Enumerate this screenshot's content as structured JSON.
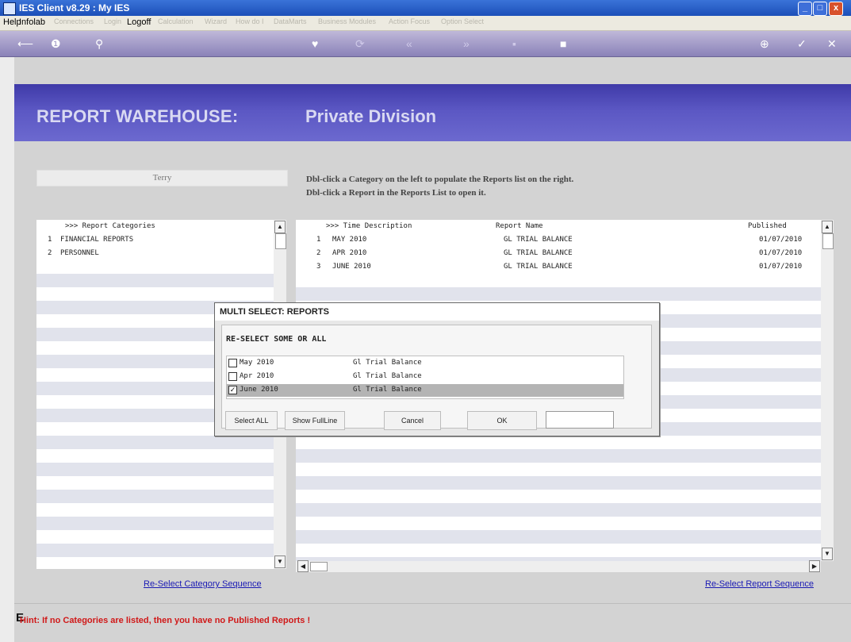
{
  "window": {
    "title": "IES Client v8.29 : My IES",
    "min": "_",
    "max": "□",
    "close": "x"
  },
  "menu": [
    "Help",
    "Infolab",
    "Connections",
    "Login",
    "Logoff",
    "Calculation",
    "Wizard",
    "How do I",
    "DataMarts",
    "Business Modules",
    "Action Focus",
    "Option Select"
  ],
  "toolbar": {
    "icons": [
      "back-arrow-icon",
      "info-icon",
      "search-icon",
      "heart-icon",
      "refresh-icon",
      "rewind-icon",
      "forward-icon",
      "stop-icon",
      "export-icon",
      "add-icon",
      "ok-icon",
      "close-icon"
    ]
  },
  "banner": {
    "title": "REPORT WAREHOUSE:",
    "subtitle": "Private Division"
  },
  "user": "Terry",
  "instructions": [
    "Dbl-click a Category on the left to populate the Reports list on the right.",
    "Dbl-click a Report in the Reports List to open it."
  ],
  "categories": {
    "header": ">>> Report Categories",
    "items": [
      {
        "num": "1",
        "name": "FINANCIAL REPORTS"
      },
      {
        "num": "2",
        "name": "PERSONNEL"
      }
    ]
  },
  "reports": {
    "headers": {
      "time": ">>> Time Description",
      "name": "Report Name",
      "published": "Published"
    },
    "rows": [
      {
        "num": "1",
        "time": "MAY 2010",
        "name": "GL TRIAL BALANCE",
        "published": "01/07/2010"
      },
      {
        "num": "2",
        "time": "APR 2010",
        "name": "GL TRIAL BALANCE",
        "published": "01/07/2010"
      },
      {
        "num": "3",
        "time": "JUNE 2010",
        "name": "GL TRIAL BALANCE",
        "published": "01/07/2010"
      }
    ]
  },
  "links": {
    "category_sequence": "Re-Select Category Sequence",
    "report_sequence": "Re-Select Report Sequence"
  },
  "hint": "Hint: If no Categories are listed, then you have no Published Reports !",
  "dialog": {
    "title": "MULTI SELECT: REPORTS",
    "heading": "RE-SELECT SOME OR ALL",
    "items": [
      {
        "label": "May 2010",
        "desc": "Gl Trial Balance",
        "checked": false
      },
      {
        "label": "Apr 2010",
        "desc": "Gl Trial Balance",
        "checked": false
      },
      {
        "label": "June 2010",
        "desc": "Gl Trial Balance",
        "checked": true
      }
    ],
    "buttons": {
      "select_all": "Select ALL",
      "show_full": "Show FullLine",
      "cancel": "Cancel",
      "ok": "OK"
    },
    "input_value": ""
  }
}
